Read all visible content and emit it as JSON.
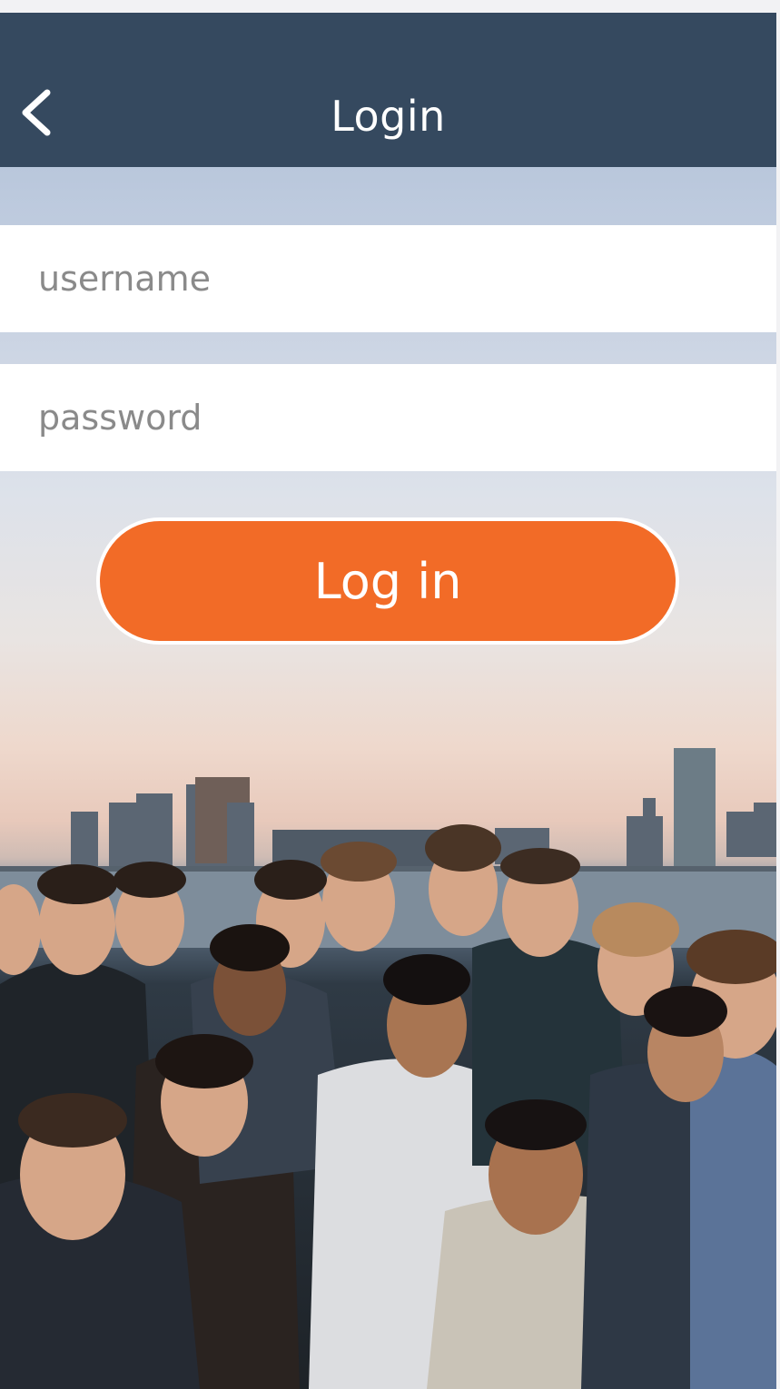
{
  "header": {
    "title": "Login",
    "back_icon": "chevron-left-icon"
  },
  "form": {
    "username_placeholder": "username",
    "password_placeholder": "password",
    "login_label": "Log in"
  },
  "colors": {
    "header_bg": "#35495f",
    "button_bg": "#f26b27",
    "field_bg": "#ffffff"
  }
}
